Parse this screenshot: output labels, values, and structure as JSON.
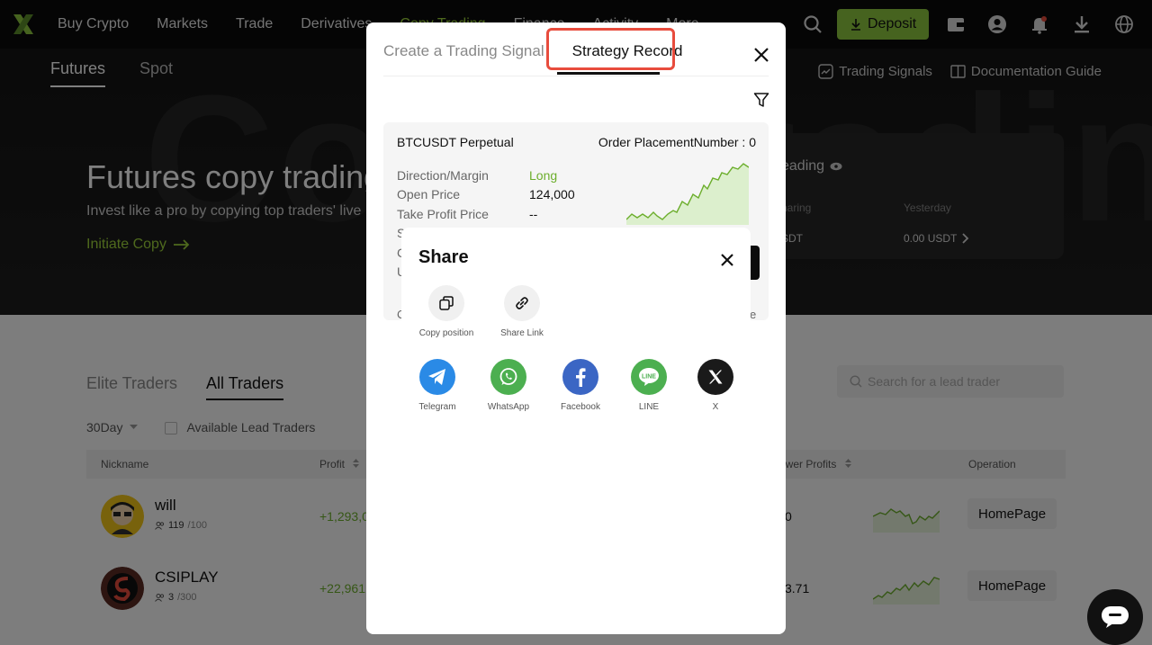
{
  "nav": {
    "items": [
      "Buy Crypto",
      "Markets",
      "Trade",
      "Derivatives",
      "Copy Trading",
      "Finance",
      "Activity",
      "More"
    ],
    "deposit_label": "Deposit",
    "accent_color": "#8dc63f"
  },
  "hero": {
    "watermark": "Copy trading",
    "subtabs": [
      "Futures",
      "Spot"
    ],
    "links": [
      "Trading Signals",
      "Documentation Guide"
    ],
    "title": "Futures copy trading",
    "subtitle": "Invest like a pro by copying top traders' live",
    "cta": "Initiate Copy",
    "card": {
      "title": "eading",
      "label_left": "haring",
      "label_right": "Yesterday",
      "value_left": "SDT",
      "value_right": "0.00 USDT"
    }
  },
  "traders": {
    "tabs": [
      "Elite Traders",
      "All Traders"
    ],
    "search_placeholder": "Search for a lead trader",
    "period": "30Day",
    "available_label": "Available Lead Traders",
    "columns": {
      "nickname": "Nickname",
      "profit": "Profit",
      "follower_profits": "ower Profits",
      "operation": "Operation"
    },
    "rows": [
      {
        "nick": "will",
        "followers": "119",
        "capacity": "/100",
        "profit": "+1,293,0",
        "follower_profit": "0",
        "action": "HomePage"
      },
      {
        "nick": "CSIPLAY",
        "followers": "3",
        "capacity": "/300",
        "profit": "+22,961.",
        "follower_profit": "3.71",
        "action": "HomePage"
      }
    ]
  },
  "modal": {
    "tabs": [
      "Create a Trading Signal",
      "Strategy Record"
    ],
    "signal": {
      "pair": "BTCUSDT Perpetual",
      "order": "Order PlacementNumber : 0",
      "labels": [
        "Direction/Margin",
        "Open Price",
        "Take Profit Price",
        "S",
        "C",
        "U"
      ],
      "direction": "Long",
      "open_price": "124,000",
      "take_profit": "--",
      "left_edge": "C",
      "right_edge": "e"
    }
  },
  "share": {
    "title": "Share",
    "copy_position": "Copy position",
    "share_link": "Share Link",
    "telegram": "Telegram",
    "whatsapp": "WhatsApp",
    "facebook": "Facebook",
    "line": "LINE",
    "x": "X",
    "colors": {
      "telegram": "#2a8ae6",
      "whatsapp": "#4caf50",
      "facebook": "#3b66c4",
      "line": "#4caf50",
      "x": "#1a1a1a"
    }
  }
}
